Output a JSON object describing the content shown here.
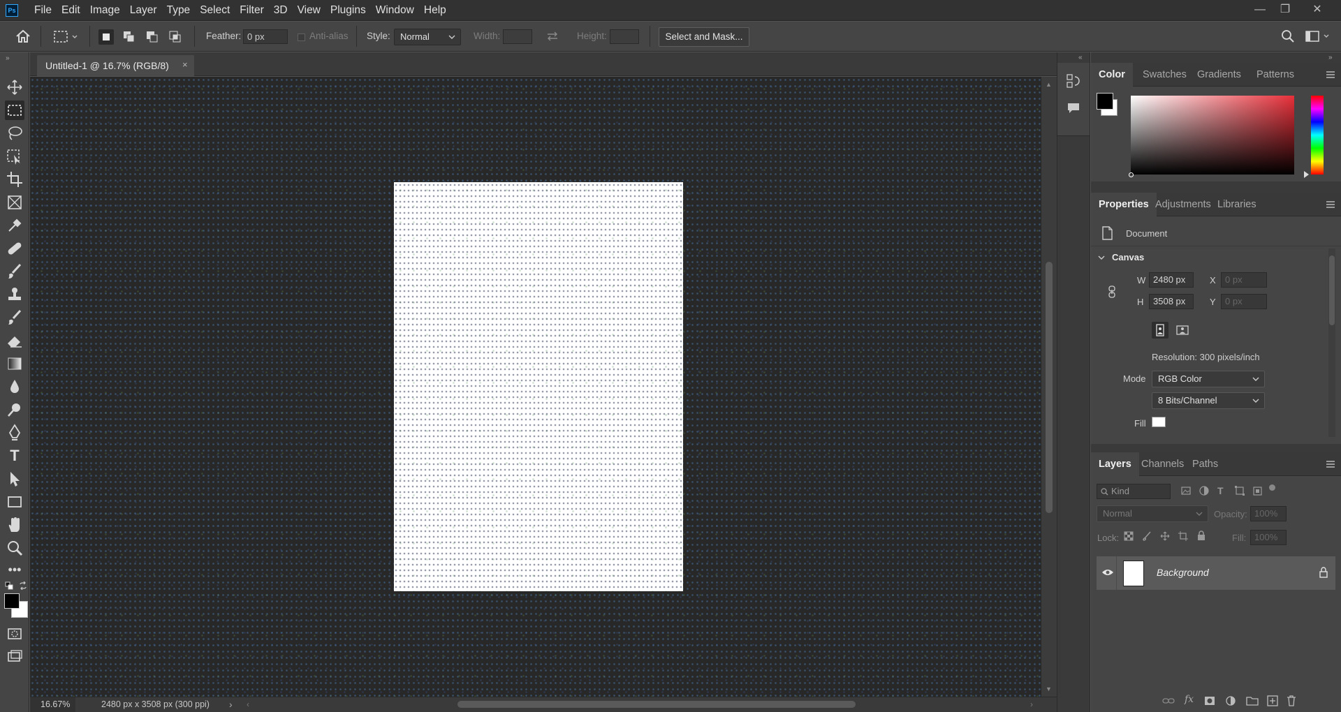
{
  "app": {
    "logo": "Ps"
  },
  "menubar": {
    "items": [
      "File",
      "Edit",
      "Image",
      "Layer",
      "Type",
      "Select",
      "Filter",
      "3D",
      "View",
      "Plugins",
      "Window",
      "Help"
    ],
    "window_controls": {
      "minimize": "—",
      "restore": "❐",
      "close": "✕"
    }
  },
  "options": {
    "feather_label": "Feather:",
    "feather_value": "0 px",
    "antialias_label": "Anti-alias",
    "style_label": "Style:",
    "style_value": "Normal",
    "width_label": "Width:",
    "height_label": "Height:",
    "select_mask_label": "Select and Mask..."
  },
  "toolbar": {
    "icons": [
      "move-icon",
      "marquee-icon",
      "lasso-icon",
      "object-select-icon",
      "crop-icon",
      "frame-icon",
      "eyedropper-icon",
      "healing-icon",
      "brush-icon",
      "stamp-icon",
      "history-brush-icon",
      "eraser-icon",
      "gradient-icon",
      "blur-icon",
      "dodge-icon",
      "pen-icon",
      "type-icon",
      "path-select-icon",
      "rectangle-icon",
      "hand-icon",
      "zoom-icon",
      "more-icon"
    ],
    "foreground_color": "#000000",
    "background_color": "#ffffff"
  },
  "document": {
    "tab_title": "Untitled-1 @ 16.7% (RGB/8)",
    "tab_close": "×"
  },
  "status": {
    "zoom": "16.67%",
    "info": "2480 px x 3508 px (300 ppi)",
    "arrow": "›"
  },
  "color_panel": {
    "tabs": [
      "Color",
      "Swatches",
      "Gradients",
      "Patterns"
    ],
    "active_tab": "Color",
    "hue_color": "#e8303a"
  },
  "properties_panel": {
    "tabs": [
      "Properties",
      "Adjustments",
      "Libraries"
    ],
    "document_label": "Document",
    "canvas_label": "Canvas",
    "w_label": "W",
    "w_value": "2480 px",
    "h_label": "H",
    "h_value": "3508 px",
    "x_label": "X",
    "x_placeholder": "0 px",
    "y_label": "Y",
    "y_placeholder": "0 px",
    "resolution": "Resolution: 300 pixels/inch",
    "mode_label": "Mode",
    "mode_value": "RGB Color",
    "bits_value": "8 Bits/Channel",
    "fill_label": "Fill",
    "fill_color": "#ffffff"
  },
  "layers_panel": {
    "tabs": [
      "Layers",
      "Channels",
      "Paths"
    ],
    "kind_label": "Kind",
    "blend_mode": "Normal",
    "opacity_label": "Opacity:",
    "opacity_value": "100%",
    "lock_label": "Lock:",
    "fill_label": "Fill:",
    "fill_value": "100%",
    "layers": [
      {
        "name": "Background",
        "visible": true,
        "locked": true
      }
    ]
  }
}
